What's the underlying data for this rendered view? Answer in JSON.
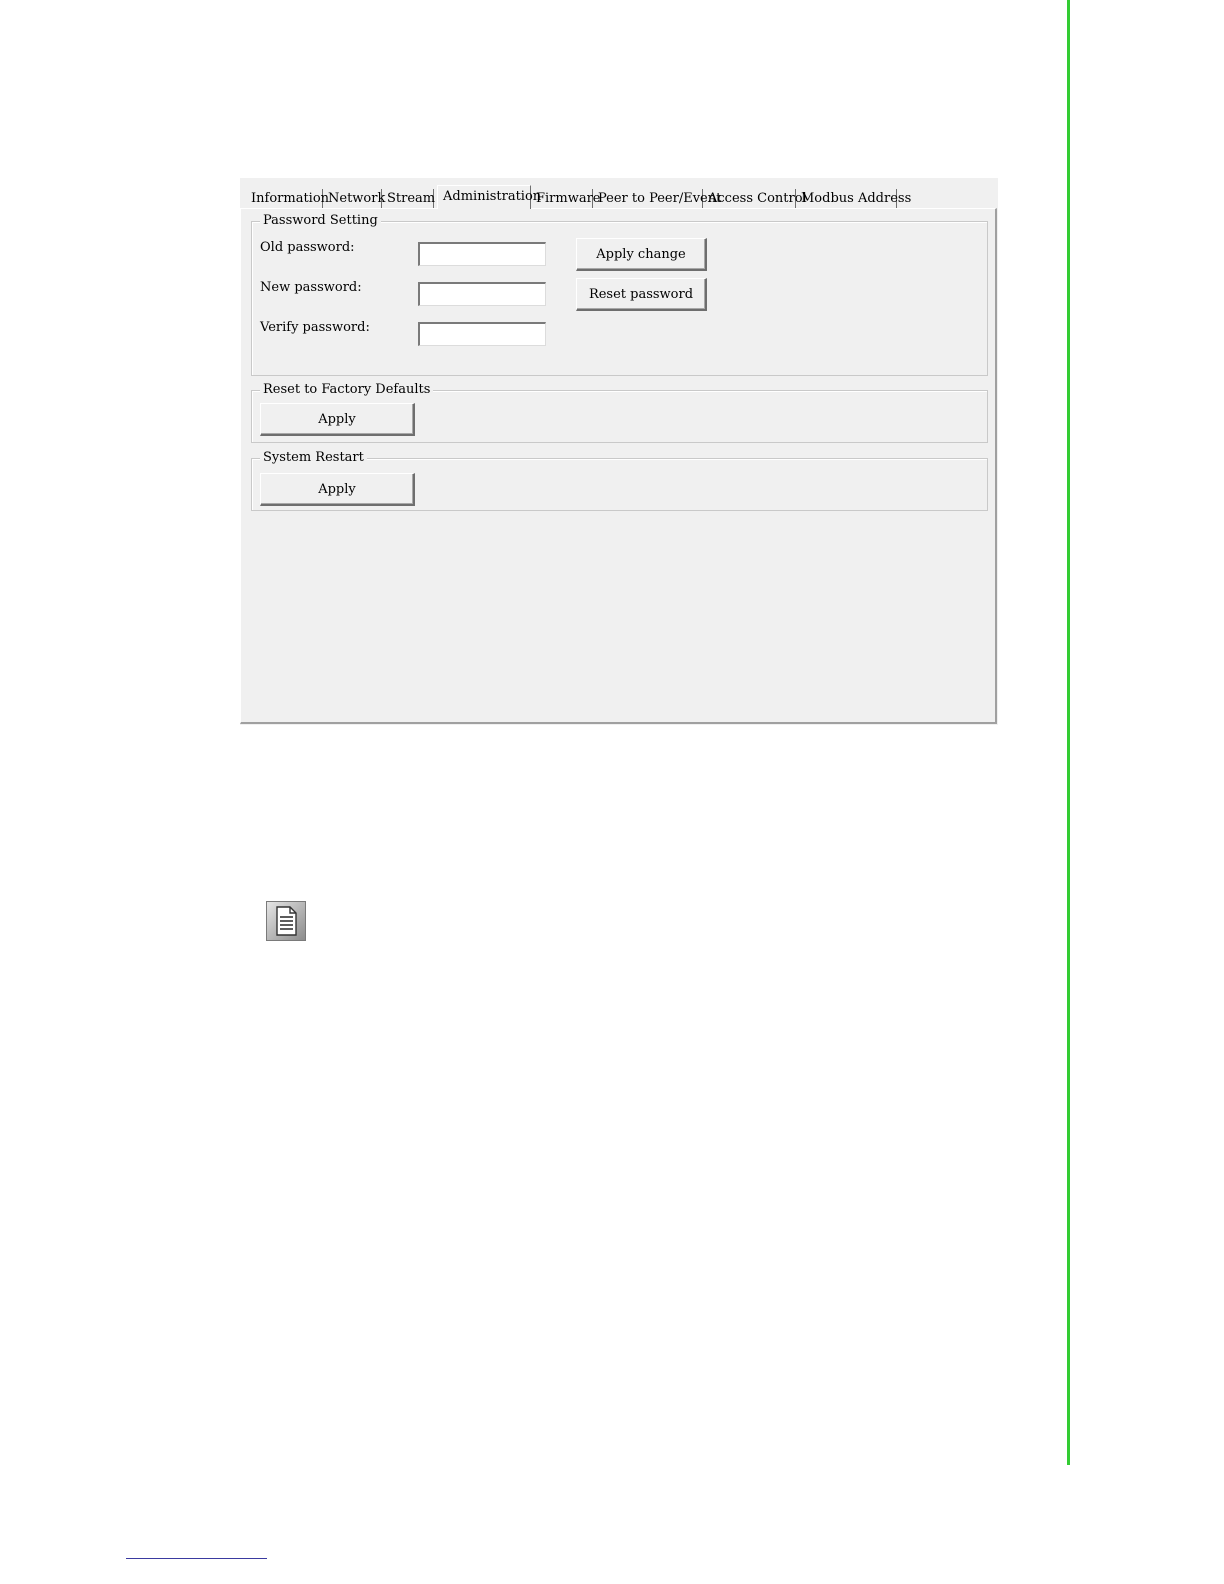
{
  "tabs": [
    {
      "label": "Information",
      "active": false
    },
    {
      "label": "Network",
      "active": false
    },
    {
      "label": "Stream",
      "active": false
    },
    {
      "label": "Administration",
      "active": true
    },
    {
      "label": "Firmware",
      "active": false
    },
    {
      "label": "Peer to Peer/Event",
      "active": false
    },
    {
      "label": "Access Control",
      "active": false
    },
    {
      "label": "Modbus Address",
      "active": false
    }
  ],
  "password_setting": {
    "title": "Password Setting",
    "old_label": "Old password:",
    "new_label": "New password:",
    "verify_label": "Verify password:",
    "old_value": "",
    "new_value": "",
    "verify_value": "",
    "apply_change_label": "Apply change",
    "reset_password_label": "Reset password"
  },
  "factory_defaults": {
    "title": "Reset to Factory Defaults",
    "apply_label": "Apply"
  },
  "system_restart": {
    "title": "System Restart",
    "apply_label": "Apply"
  },
  "icons": {
    "note": "document-note-icon"
  },
  "colors": {
    "side_rule": "#33cc33",
    "dialog_bg": "#f0f0f0"
  }
}
